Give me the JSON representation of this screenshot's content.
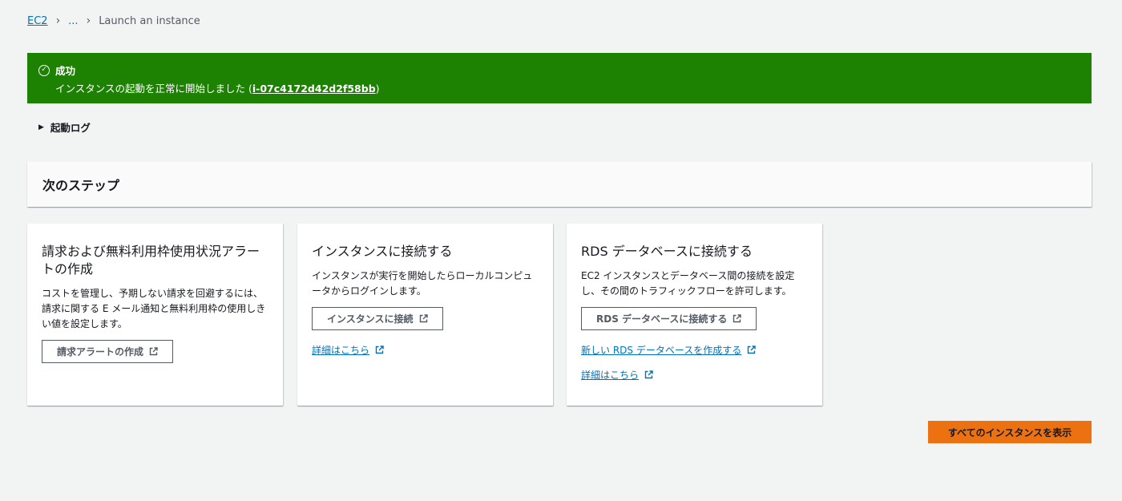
{
  "breadcrumb": {
    "root": "EC2",
    "ellipsis": "...",
    "current": "Launch an instance"
  },
  "flash": {
    "title": "成功",
    "message": "インスタンスの起動を正常に開始しました (",
    "instance_id": "i-07c4172d42d2f58bb",
    "message_end": ")"
  },
  "expander": {
    "label": "起動ログ"
  },
  "next_steps": {
    "title": "次のステップ"
  },
  "cards": [
    {
      "title": "請求および無料利用枠使用状況アラートの作成",
      "description": "コストを管理し、予期しない請求を回避するには、請求に関する E メール通知と無料利用枠の使用しきい値を設定します。",
      "button": "請求アラートの作成"
    },
    {
      "title": "インスタンスに接続する",
      "description": "インスタンスが実行を開始したらローカルコンピュータからログインします。",
      "button": "インスタンスに接続",
      "link": "詳細はこちら"
    },
    {
      "title": "RDS データベースに接続する",
      "description": "EC2 インスタンスとデータベース間の接続を設定し、その間のトラフィックフローを許可します。",
      "button": "RDS データベースに接続する",
      "link1": "新しい RDS データベースを作成する",
      "link2": "詳細はこちら"
    }
  ],
  "primary_button": "すべてのインスタンスを表示",
  "colors": {
    "success": "#1d8102",
    "link": "#0073bb",
    "primary": "#ec7211",
    "background": "#f2f3f3"
  },
  "icons": {
    "success": "check-circle-icon",
    "external": "external-link-icon",
    "expand": "caret-right-icon"
  }
}
